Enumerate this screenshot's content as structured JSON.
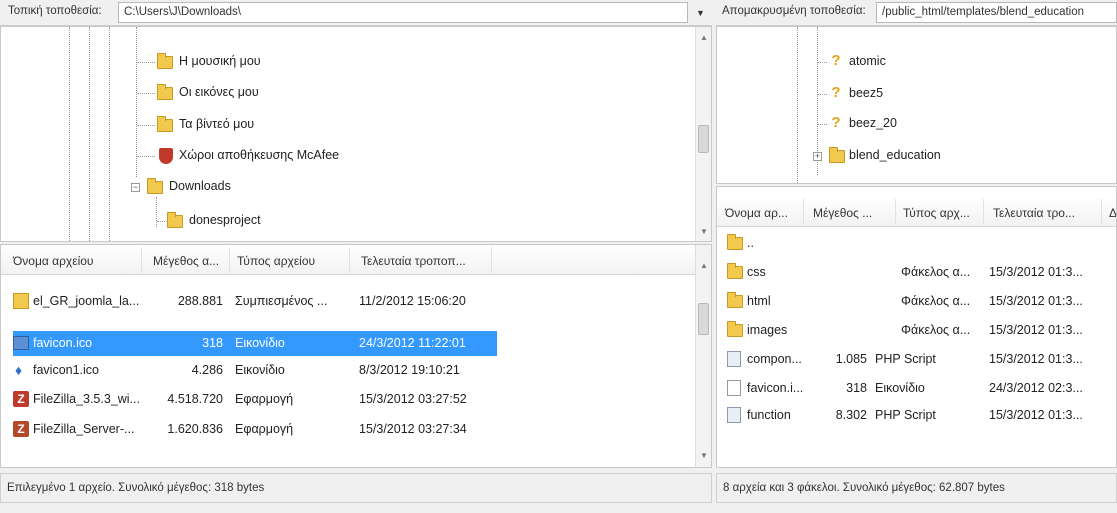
{
  "local": {
    "path_label": "Τοπική τοποθεσία:",
    "path_value": "C:\\Users\\J\\Downloads\\",
    "tree": [
      {
        "label": "Η μουσική μου",
        "icon": "music-folder-icon"
      },
      {
        "label": "Οι εικόνες μου",
        "icon": "pictures-folder-icon"
      },
      {
        "label": "Τα βίντεό μου",
        "icon": "videos-folder-icon"
      },
      {
        "label": "Χώροι αποθήκευσης McAfee",
        "icon": "mcafee-vault-icon"
      },
      {
        "label": "Downloads",
        "icon": "downloads-folder-icon"
      },
      {
        "label": "donesproject",
        "icon": "folder-icon"
      }
    ],
    "columns": [
      "Όνομα αρχείου",
      "Μέγεθος α...",
      "Τύπος αρχείου",
      "Τελευταία τροποπ..."
    ],
    "files": [
      {
        "name": "el_GR_joomla_la...",
        "size": "288.881",
        "type": "Συμπιεσμένος ...",
        "modified": "11/2/2012 15:06:20",
        "icon": "zip-icon"
      },
      {
        "name": "favicon.ico",
        "size": "318",
        "type": "Εικονίδιο",
        "modified": "24/3/2012 11:22:01",
        "icon": "image-icon"
      },
      {
        "name": "favicon1.ico",
        "size": "4.286",
        "type": "Εικονίδιο",
        "modified": "8/3/2012 19:10:21",
        "icon": "pin-icon"
      },
      {
        "name": "FileZilla_3.5.3_wi...",
        "size": "4.518.720",
        "type": "Εφαρμογή",
        "modified": "15/3/2012 03:27:52",
        "icon": "filezilla-icon"
      },
      {
        "name": "FileZilla_Server-...",
        "size": "1.620.836",
        "type": "Εφαρμογή",
        "modified": "15/3/2012 03:27:34",
        "icon": "filezilla-server-icon"
      }
    ],
    "status": "Επιλεγμένο 1 αρχείο. Συνολικό μέγεθος: 318 bytes"
  },
  "remote": {
    "path_label": "Απομακρυσμένη τοποθεσία:",
    "path_value": "/public_html/templates/blend_education",
    "tree": [
      {
        "label": "atomic",
        "icon": "question-folder-icon"
      },
      {
        "label": "beez5",
        "icon": "question-folder-icon"
      },
      {
        "label": "beez_20",
        "icon": "question-folder-icon"
      },
      {
        "label": "blend_education",
        "icon": "folder-icon"
      }
    ],
    "columns": [
      "Όνομα αρ...",
      "Μέγεθος ...",
      "Τύπος αρχ...",
      "Τελευταία τρο...",
      "Δ"
    ],
    "files": [
      {
        "name": "..",
        "size": "",
        "type": "",
        "modified": "",
        "icon": "folder-icon"
      },
      {
        "name": "css",
        "size": "",
        "type": "Φάκελος α...",
        "modified": "15/3/2012 01:3...",
        "icon": "folder-icon"
      },
      {
        "name": "html",
        "size": "",
        "type": "Φάκελος α...",
        "modified": "15/3/2012 01:3...",
        "icon": "folder-icon"
      },
      {
        "name": "images",
        "size": "",
        "type": "Φάκελος α...",
        "modified": "15/3/2012 01:3...",
        "icon": "folder-icon"
      },
      {
        "name": "compon...",
        "size": "1.085",
        "type": "PHP Script",
        "modified": "15/3/2012 01:3...",
        "icon": "php-icon"
      },
      {
        "name": "favicon.i...",
        "size": "318",
        "type": "Εικονίδιο",
        "modified": "24/3/2012 02:3...",
        "icon": "file-icon"
      },
      {
        "name": "function",
        "size": "8.302",
        "type": "PHP Script",
        "modified": "15/3/2012 01:3...",
        "icon": "php-icon"
      }
    ],
    "status": "8 αρχεία και 3 φάκελοι. Συνολικό μέγεθος: 62.807 bytes"
  },
  "colors": {
    "selection": "#3399ff",
    "folder": "#f2c94c"
  }
}
